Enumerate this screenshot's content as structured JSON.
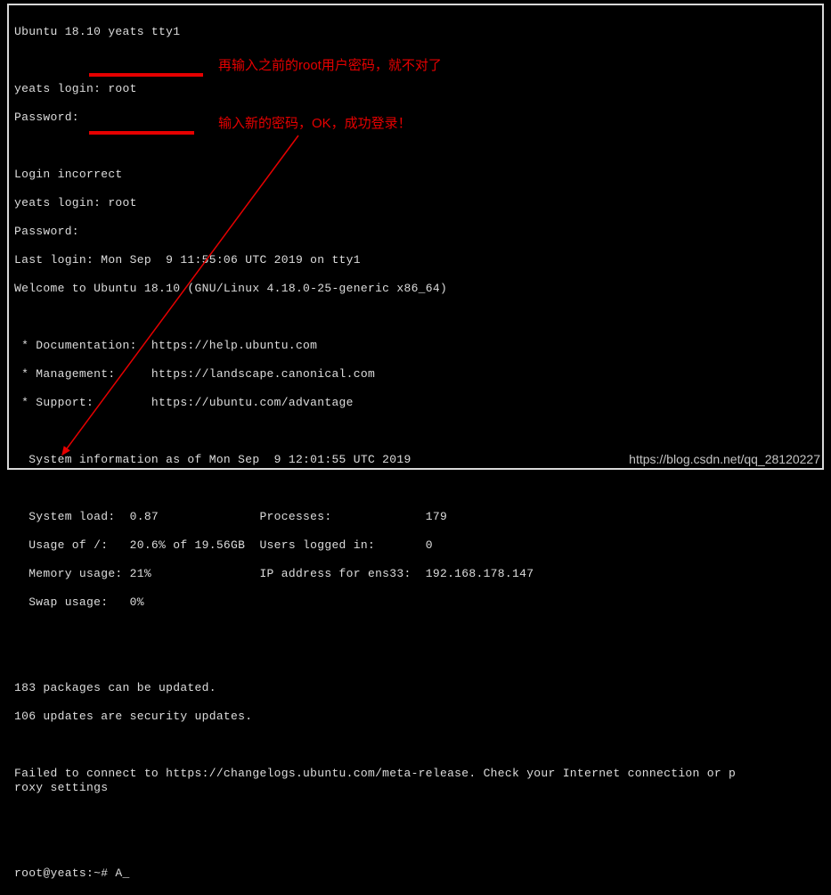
{
  "terminal": {
    "header": "Ubuntu 18.10 yeats tty1",
    "login1_prompt": "yeats login: root",
    "password1_prompt": "Password:",
    "login_incorrect": "Login incorrect",
    "login2_prompt": "yeats login: root",
    "password2_prompt": "Password:",
    "last_login": "Last login: Mon Sep  9 11:55:06 UTC 2019 on tty1",
    "welcome": "Welcome to Ubuntu 18.10 (GNU/Linux 4.18.0-25-generic x86_64)",
    "docs": " * Documentation:  https://help.ubuntu.com",
    "mgmt": " * Management:     https://landscape.canonical.com",
    "support": " * Support:        https://ubuntu.com/advantage",
    "sysinfo_header": "  System information as of Mon Sep  9 12:01:55 UTC 2019",
    "load": "  System load:  0.87              Processes:             179",
    "usage": "  Usage of /:   20.6% of 19.56GB  Users logged in:       0",
    "memory": "  Memory usage: 21%               IP address for ens33:  192.168.178.147",
    "swap": "  Swap usage:   0%",
    "packages_update": "183 packages can be updated.",
    "security_updates": "106 updates are security updates.",
    "failed_connect": "Failed to connect to https://changelogs.ubuntu.com/meta-release. Check your Internet connection or p\nroxy settings",
    "prompt": "root@yeats:~# A_"
  },
  "annotations": {
    "note1": "再输入之前的root用户密码，就不对了",
    "note2": "输入新的密码，OK，成功登录！"
  },
  "watermark": "https://blog.csdn.net/qq_28120227"
}
